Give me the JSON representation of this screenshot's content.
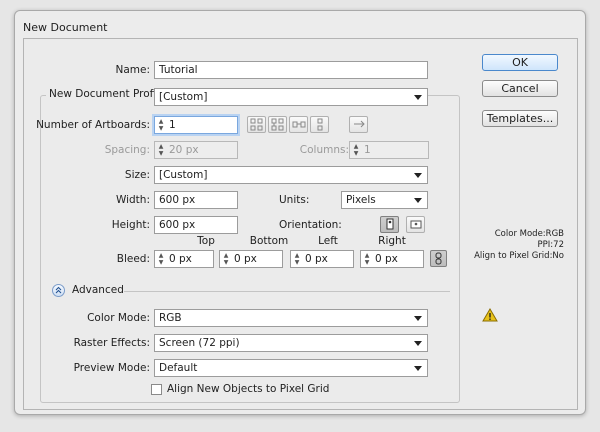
{
  "dialog": {
    "title": "New Document"
  },
  "name": {
    "label": "Name:",
    "value": "Tutorial"
  },
  "profile": {
    "label": "New Document Profile:",
    "value": "[Custom]"
  },
  "artboards": {
    "count_label": "Number of Artboards:",
    "count_value": "1",
    "spacing_label": "Spacing:",
    "spacing_value": "20 px",
    "columns_label": "Columns:",
    "columns_value": "1"
  },
  "size": {
    "label": "Size:",
    "value": "[Custom]"
  },
  "width": {
    "label": "Width:",
    "value": "600 px"
  },
  "units": {
    "label": "Units:",
    "value": "Pixels"
  },
  "height": {
    "label": "Height:",
    "value": "600 px"
  },
  "orientation": {
    "label": "Orientation:"
  },
  "bleed": {
    "label": "Bleed:",
    "top_label": "Top",
    "top_value": "0 px",
    "bottom_label": "Bottom",
    "bottom_value": "0 px",
    "left_label": "Left",
    "left_value": "0 px",
    "right_label": "Right",
    "right_value": "0 px"
  },
  "advanced": {
    "label": "Advanced",
    "color_mode_label": "Color Mode:",
    "color_mode_value": "RGB",
    "raster_label": "Raster Effects:",
    "raster_value": "Screen (72 ppi)",
    "preview_label": "Preview Mode:",
    "preview_value": "Default",
    "align_label": "Align New Objects to Pixel Grid"
  },
  "buttons": {
    "ok": "OK",
    "cancel": "Cancel",
    "templates": "Templates..."
  },
  "info": {
    "color_mode": "Color Mode:RGB",
    "ppi": "PPI:72",
    "align": "Align to Pixel Grid:No"
  },
  "icons": {
    "grid_by_row": "grid-by-row-icon",
    "grid_by_column": "grid-by-column-icon",
    "arrange_by_row": "arrange-by-row-icon",
    "arrange_by_column": "arrange-by-column-icon",
    "right_to_left": "right-to-left-icon",
    "portrait": "portrait-icon",
    "landscape": "landscape-icon",
    "link": "link-icon",
    "warning": "warning-icon",
    "advanced_toggle": "chevron-up-icon"
  },
  "colors": {
    "accent": "#4a88cc",
    "focus": "#7aa7de",
    "warning": "#e8c21a"
  }
}
